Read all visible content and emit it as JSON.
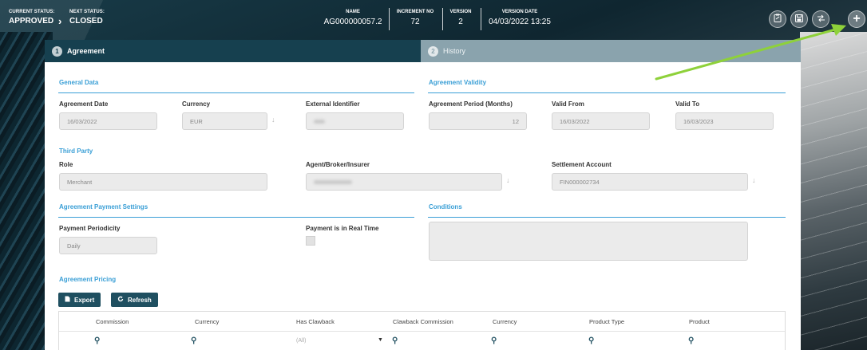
{
  "header": {
    "current_status_label": "CURRENT STATUS:",
    "current_status_value": "APPROVED",
    "next_status_label": "NEXT STATUS:",
    "next_status_value": "CLOSED",
    "name_label": "NAME",
    "name_value": "AG000000057.2",
    "increment_label": "INCREMENT NO",
    "increment_value": "72",
    "version_label": "VERSION",
    "version_value": "2",
    "version_date_label": "VERSION DATE",
    "version_date_value": "04/03/2022 13:25"
  },
  "tabs": [
    {
      "num": "1",
      "label": "Agreement"
    },
    {
      "num": "2",
      "label": "History"
    }
  ],
  "general_data": {
    "title": "General Data",
    "agreement_date_label": "Agreement Date",
    "agreement_date_value": "16/03/2022",
    "currency_label": "Currency",
    "currency_value": "EUR",
    "external_identifier_label": "External Identifier"
  },
  "validity": {
    "title": "Agreement Validity",
    "period_label": "Agreement Period (Months)",
    "period_value": "12",
    "valid_from_label": "Valid From",
    "valid_from_value": "16/03/2022",
    "valid_to_label": "Valid To",
    "valid_to_value": "16/03/2023"
  },
  "third_party": {
    "title": "Third Party",
    "role_label": "Role",
    "role_value": "Merchant",
    "agent_label": "Agent/Broker/Insurer",
    "settlement_label": "Settlement Account",
    "settlement_value": "FIN000002734"
  },
  "payment": {
    "title": "Agreement Payment Settings",
    "periodicity_label": "Payment Periodicity",
    "periodicity_value": "Daily",
    "realtime_label": "Payment is in Real Time"
  },
  "conditions": {
    "title": "Conditions"
  },
  "pricing": {
    "title": "Agreement Pricing",
    "export_label": "Export",
    "refresh_label": "Refresh",
    "columns": [
      "Commission",
      "Currency",
      "Has Clawback",
      "Clawback Commission",
      "Currency",
      "Product Type",
      "Product"
    ],
    "filter_all": "(All)"
  },
  "colors": {
    "accent": "#3a9fd6",
    "header_bg": "#16404f",
    "button_bg": "#1f4f60",
    "annotation_arrow": "#8ed13a"
  },
  "icons": {
    "export": "file-icon",
    "refresh": "refresh-icon",
    "search": "search-icon",
    "header_buttons": [
      "clipboard-icon",
      "save-icon",
      "compare-icon",
      "plus-icon"
    ]
  }
}
